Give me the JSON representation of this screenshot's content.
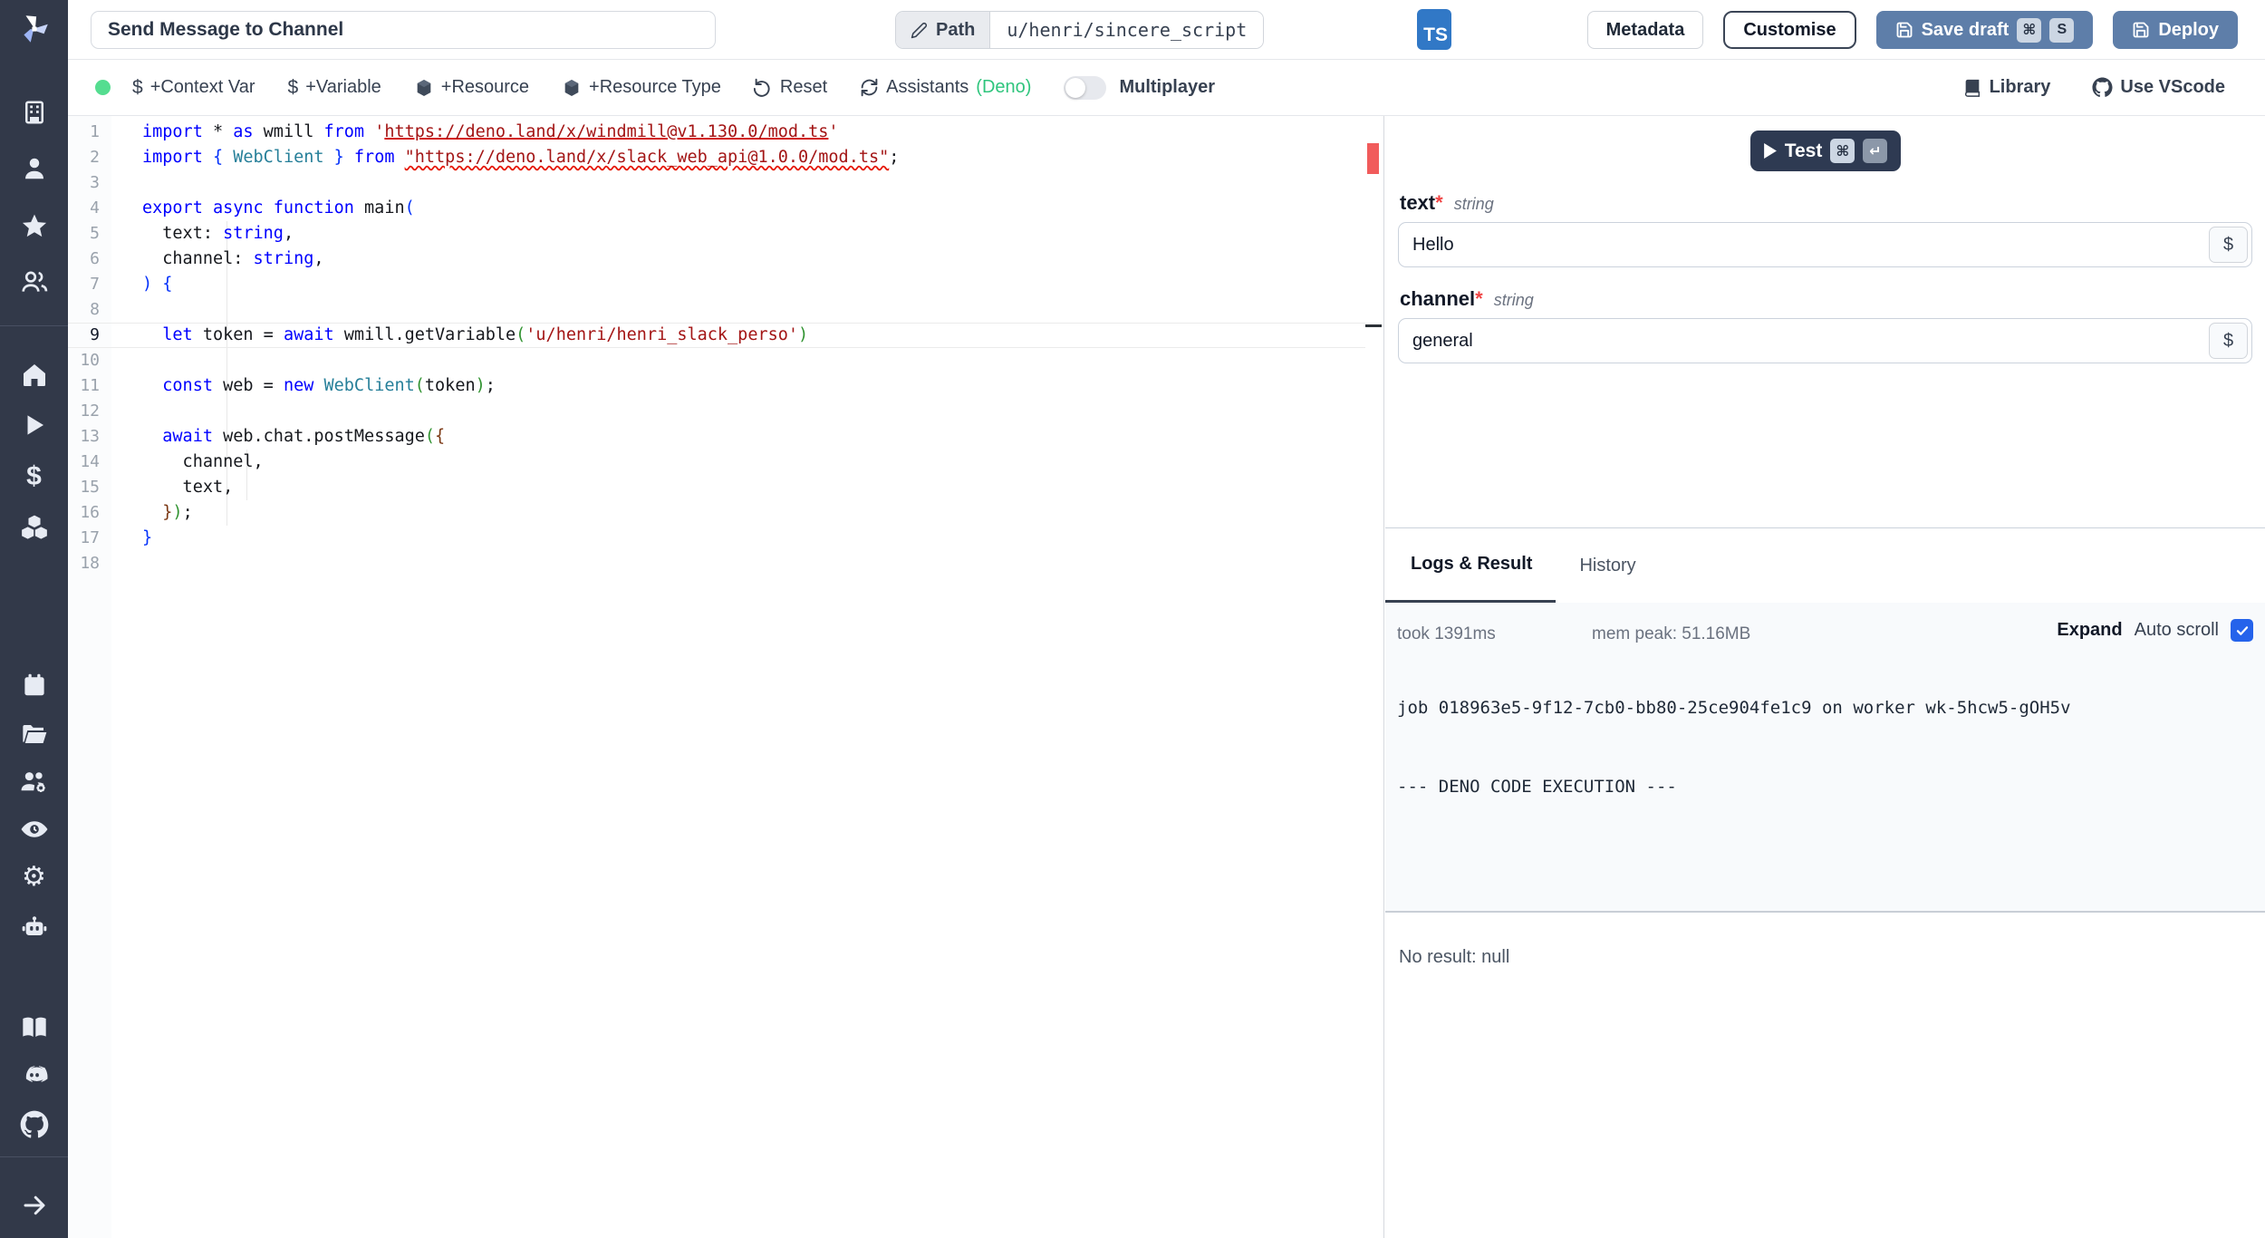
{
  "topbar": {
    "title_value": "Send Message to Channel",
    "path_label": "Path",
    "path_value": "u/henri/sincere_script",
    "lang_badge": "TS",
    "metadata_label": "Metadata",
    "customise_label": "Customise",
    "save_draft_label": "Save draft",
    "save_kbd_1": "⌘",
    "save_kbd_2": "S",
    "deploy_label": "Deploy"
  },
  "toolbar": {
    "dollar_icon": "$",
    "context_var_label": "+Context Var",
    "variable_label": "+Variable",
    "resource_label": "+Resource",
    "resource_type_label": "+Resource Type",
    "reset_label": "Reset",
    "assistants_label": "Assistants",
    "assistants_lang": "(Deno)",
    "multiplayer_label": "Multiplayer",
    "library_label": "Library",
    "vscode_label": "Use VScode"
  },
  "editor": {
    "lines": [
      {
        "n": "1",
        "t": [
          [
            "k",
            "import "
          ],
          [
            "p",
            "* "
          ],
          [
            "k",
            "as "
          ],
          [
            "p",
            "wmill "
          ],
          [
            "k",
            "from "
          ],
          [
            "s",
            "'"
          ],
          [
            "su",
            "https://deno.land/x/windmill@v1.130.0/mod.ts"
          ],
          [
            "s",
            "'"
          ]
        ]
      },
      {
        "n": "2",
        "t": [
          [
            "k",
            "import "
          ],
          [
            "b1",
            "{"
          ],
          [
            "p",
            " "
          ],
          [
            "t",
            "WebClient"
          ],
          [
            "p",
            " "
          ],
          [
            "b1",
            "}"
          ],
          [
            "p",
            " "
          ],
          [
            "k",
            "from "
          ],
          [
            "sw",
            "\"https://deno.land/x/slack_web_api@1.0.0/mod.ts\""
          ],
          [
            "p",
            ";"
          ]
        ]
      },
      {
        "n": "3",
        "t": []
      },
      {
        "n": "4",
        "t": [
          [
            "k",
            "export "
          ],
          [
            "k",
            "async "
          ],
          [
            "k",
            "function "
          ],
          [
            "p",
            "main"
          ],
          [
            "b1",
            "("
          ]
        ]
      },
      {
        "n": "5",
        "t": [
          [
            "p",
            "  text: "
          ],
          [
            "k",
            "string"
          ],
          [
            "p",
            ","
          ]
        ]
      },
      {
        "n": "6",
        "t": [
          [
            "p",
            "  channel: "
          ],
          [
            "k",
            "string"
          ],
          [
            "p",
            ","
          ]
        ]
      },
      {
        "n": "7",
        "t": [
          [
            "b1",
            ")"
          ],
          [
            "p",
            " "
          ],
          [
            "b1",
            "{"
          ]
        ]
      },
      {
        "n": "8",
        "t": []
      },
      {
        "n": "9",
        "cur": true,
        "t": [
          [
            "p",
            "  "
          ],
          [
            "k",
            "let"
          ],
          [
            "p",
            " token = "
          ],
          [
            "k",
            "await"
          ],
          [
            "p",
            " wmill.getVariable"
          ],
          [
            "b2",
            "("
          ],
          [
            "s",
            "'u/henri/henri_slack_perso'"
          ],
          [
            "b2",
            ")"
          ]
        ]
      },
      {
        "n": "10",
        "t": []
      },
      {
        "n": "11",
        "t": [
          [
            "p",
            "  "
          ],
          [
            "k",
            "const"
          ],
          [
            "p",
            " web = "
          ],
          [
            "k",
            "new"
          ],
          [
            "p",
            " "
          ],
          [
            "t",
            "WebClient"
          ],
          [
            "b2",
            "("
          ],
          [
            "p",
            "token"
          ],
          [
            "b2",
            ")"
          ],
          [
            "p",
            ";"
          ]
        ]
      },
      {
        "n": "12",
        "t": []
      },
      {
        "n": "13",
        "t": [
          [
            "p",
            "  "
          ],
          [
            "k",
            "await"
          ],
          [
            "p",
            " web.chat.postMessage"
          ],
          [
            "b2",
            "("
          ],
          [
            "b3",
            "{"
          ]
        ]
      },
      {
        "n": "14",
        "t": [
          [
            "p",
            "    channel,"
          ]
        ]
      },
      {
        "n": "15",
        "t": [
          [
            "p",
            "    text,"
          ]
        ]
      },
      {
        "n": "16",
        "t": [
          [
            "p",
            "  "
          ],
          [
            "b3",
            "}"
          ],
          [
            "b2",
            ")"
          ],
          [
            "p",
            ";"
          ]
        ]
      },
      {
        "n": "17",
        "t": [
          [
            "b1",
            "}"
          ]
        ]
      },
      {
        "n": "18",
        "t": []
      }
    ]
  },
  "form": {
    "test_label": "Test",
    "test_kbd_1": "⌘",
    "test_kbd_2": "↵",
    "fields": [
      {
        "name": "text",
        "star": "*",
        "type": "string",
        "value": "Hello",
        "dollar": "$"
      },
      {
        "name": "channel",
        "star": "*",
        "type": "string",
        "value": "general",
        "dollar": "$"
      }
    ]
  },
  "logs": {
    "tab_logs": "Logs & Result",
    "tab_history": "History",
    "took": "took 1391ms",
    "mem_peak": "mem peak: 51.16MB",
    "expand_label": "Expand",
    "autoscroll_label": "Auto scroll",
    "log_line_1": "job 018963e5-9f12-7cb0-bb80-25ce904fe1c9 on worker wk-5hcw5-gOH5v",
    "log_line_2": "--- DENO CODE EXECUTION ---",
    "no_result": "No result: null"
  },
  "colors": {
    "sidebar_bg": "#323949",
    "ts_badge": "#3178c6",
    "primary_button": "#5e7ea9",
    "test_button": "#2e3a52",
    "status_dot_green": "#55dd90",
    "deno_green": "#2fc57d",
    "checkbox_blue": "#2563eb",
    "error_red": "#e51400"
  }
}
